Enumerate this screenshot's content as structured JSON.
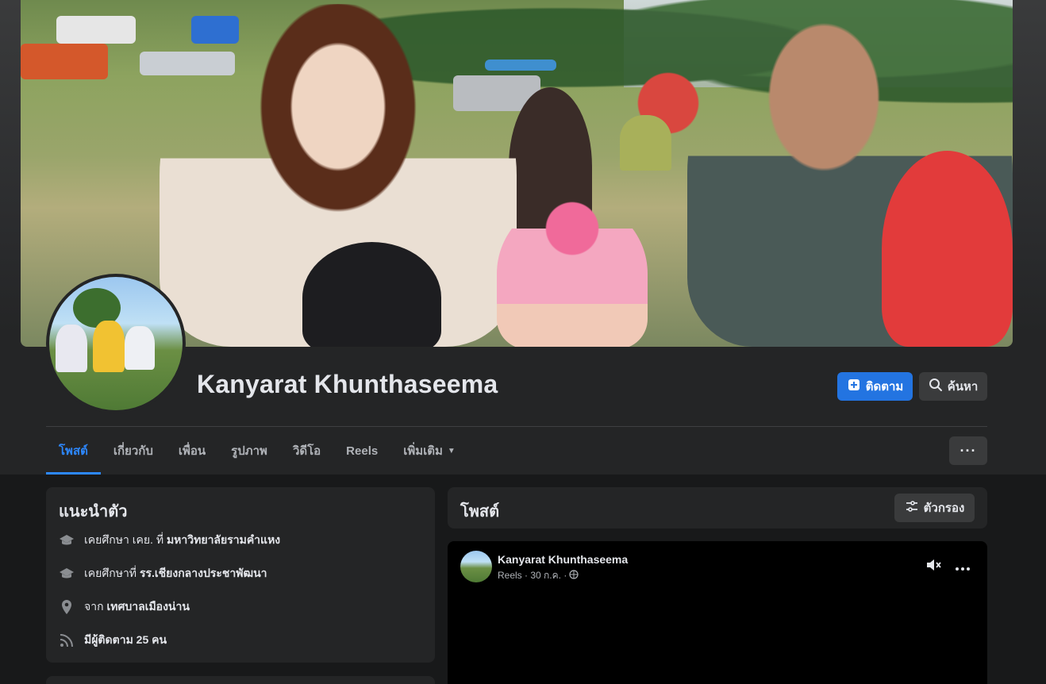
{
  "profile": {
    "name": "Kanyarat Khunthaseema"
  },
  "actions": {
    "follow_label": "ติดตาม",
    "search_label": "ค้นหา",
    "more_label": "···"
  },
  "tabs": [
    {
      "label": "โพสต์",
      "active": true
    },
    {
      "label": "เกี่ยวกับ",
      "active": false
    },
    {
      "label": "เพื่อน",
      "active": false
    },
    {
      "label": "รูปภาพ",
      "active": false
    },
    {
      "label": "วิดีโอ",
      "active": false
    },
    {
      "label": "Reels",
      "active": false
    },
    {
      "label": "เพิ่มเติม",
      "active": false
    }
  ],
  "intro": {
    "title": "แนะนำตัว",
    "items": [
      {
        "icon": "graduation-cap-icon",
        "prefix": "เคยศึกษา เคย. ที่ ",
        "bold": "มหาวิทยาลัยรามคำแหง"
      },
      {
        "icon": "graduation-cap-icon",
        "prefix": "เคยศึกษาที่ ",
        "bold": "รร.เชียงกลางประชาพัฒนา"
      },
      {
        "icon": "location-pin-icon",
        "prefix": "จาก ",
        "bold": "เทศบาลเมืองน่าน"
      },
      {
        "icon": "rss-icon",
        "prefix": "",
        "bold": "มีผู้ติดตาม 25 คน"
      }
    ]
  },
  "posts": {
    "title": "โพสต์",
    "filter_label": "ตัวกรอง"
  },
  "post": {
    "author": "Kanyarat Khunthaseema",
    "meta": "Reels · 30 ก.ค. ·"
  },
  "colors": {
    "accent": "#2d88ff",
    "follow_button": "#2374e1",
    "background": "#18191a",
    "card": "#242526"
  }
}
